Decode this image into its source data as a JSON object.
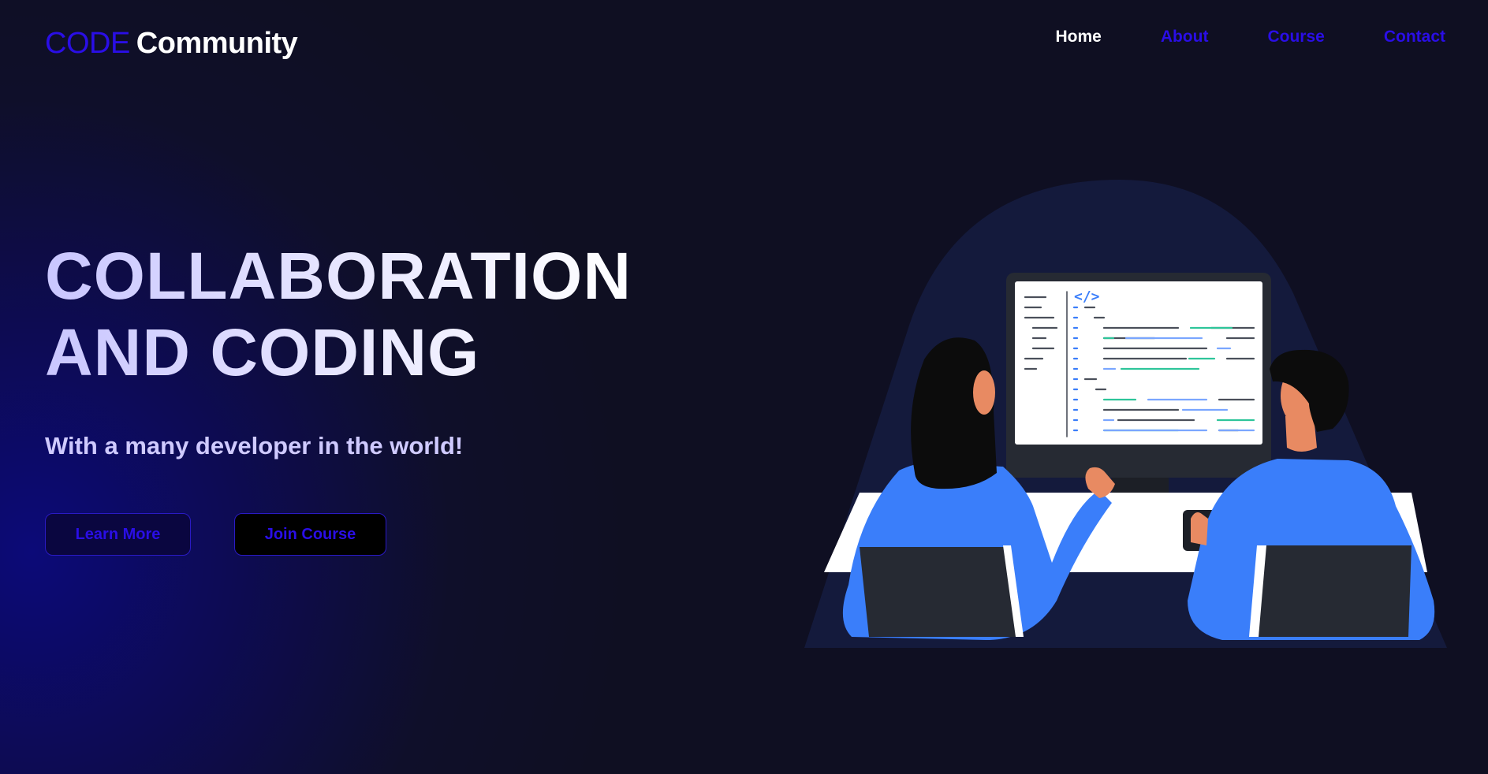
{
  "brand": {
    "code": "CODE",
    "community": "Community"
  },
  "nav": {
    "home": "Home",
    "about": "About",
    "course": "Course",
    "contact": "Contact"
  },
  "hero": {
    "title_line1": "COLLABORATION",
    "title_line2": "AND CODING",
    "subtitle": "With a many developer in the world!",
    "learn_more": "Learn More",
    "join_course": "Join Course"
  },
  "illustration": {
    "code_tag": "</>",
    "icon": "developers-at-computer-illustration"
  },
  "colors": {
    "accent": "#2a0ee6",
    "background": "#0f0f22",
    "illustration_blue": "#3a7efa"
  }
}
